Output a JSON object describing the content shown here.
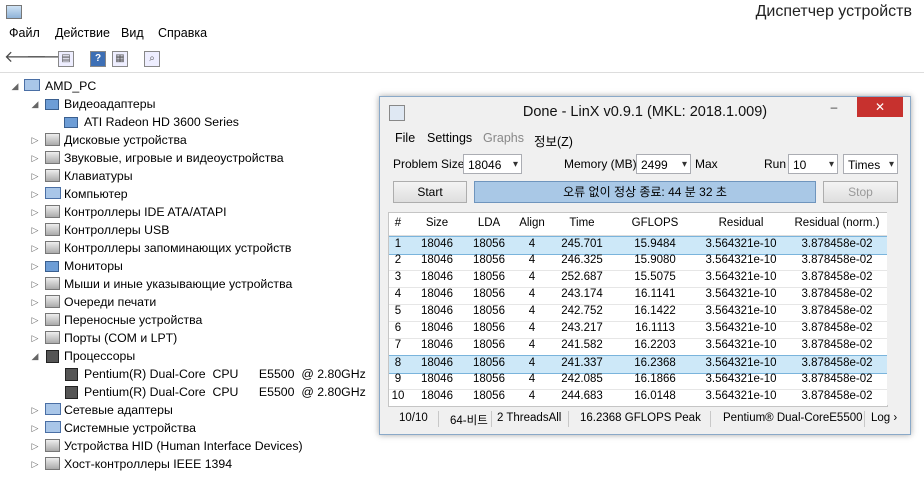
{
  "window": {
    "title": "Диспетчер устройств"
  },
  "menu": [
    "Файл",
    "Действие",
    "Вид",
    "Справка"
  ],
  "toolbar": {
    "back_icon": "back-arrow-icon",
    "forward_icon": "forward-arrow-icon",
    "help_label": "?"
  },
  "tree": {
    "root": "AMD_PC",
    "items": [
      {
        "label": "Видеоадаптеры",
        "expanded": true,
        "children": [
          "ATI Radeon HD 3600 Series"
        ]
      },
      {
        "label": "Дисковые устройства"
      },
      {
        "label": "Звуковые, игровые и видеоустройства"
      },
      {
        "label": "Клавиатуры"
      },
      {
        "label": "Компьютер"
      },
      {
        "label": "Контроллеры IDE ATA/ATAPI"
      },
      {
        "label": "Контроллеры USB"
      },
      {
        "label": "Контроллеры запоминающих устройств"
      },
      {
        "label": "Мониторы"
      },
      {
        "label": "Мыши и иные указывающие устройства"
      },
      {
        "label": "Очереди печати"
      },
      {
        "label": "Переносные устройства"
      },
      {
        "label": "Порты (COM и LPT)"
      },
      {
        "label": "Процессоры",
        "expanded": true,
        "children": [
          "Pentium(R) Dual-Core  CPU      E5500  @ 2.80GHz",
          "Pentium(R) Dual-Core  CPU      E5500  @ 2.80GHz"
        ]
      },
      {
        "label": "Сетевые адаптеры"
      },
      {
        "label": "Системные устройства"
      },
      {
        "label": "Устройства HID (Human Interface Devices)"
      },
      {
        "label": "Хост-контроллеры IEEE 1394"
      }
    ]
  },
  "linx": {
    "title": "Done - LinX v0.9.1 (MKL: 2018.1.009)",
    "minimize": "–",
    "close": "✕",
    "menu": [
      "File",
      "Settings",
      "Graphs",
      "정보(Z)"
    ],
    "problem_size_label": "Problem Size:",
    "problem_size": "18046",
    "memory_label": "Memory (MB):",
    "memory": "2499",
    "max_label": "Max",
    "run_label": "Run",
    "run": "10",
    "run_unit": "Times",
    "start": "Start",
    "status": "오류 없이 정상 종료: 44 분 32 초",
    "stop": "Stop",
    "columns": [
      "#",
      "Size",
      "LDA",
      "Align",
      "Time",
      "GFLOPS",
      "Residual",
      "Residual (norm.)"
    ],
    "rows": [
      [
        "1",
        "18046",
        "18056",
        "4",
        "245.701",
        "15.9484",
        "3.564321e-10",
        "3.878458e-02"
      ],
      [
        "2",
        "18046",
        "18056",
        "4",
        "246.325",
        "15.9080",
        "3.564321e-10",
        "3.878458e-02"
      ],
      [
        "3",
        "18046",
        "18056",
        "4",
        "252.687",
        "15.5075",
        "3.564321e-10",
        "3.878458e-02"
      ],
      [
        "4",
        "18046",
        "18056",
        "4",
        "243.174",
        "16.1141",
        "3.564321e-10",
        "3.878458e-02"
      ],
      [
        "5",
        "18046",
        "18056",
        "4",
        "242.752",
        "16.1422",
        "3.564321e-10",
        "3.878458e-02"
      ],
      [
        "6",
        "18046",
        "18056",
        "4",
        "243.217",
        "16.1113",
        "3.564321e-10",
        "3.878458e-02"
      ],
      [
        "7",
        "18046",
        "18056",
        "4",
        "241.582",
        "16.2203",
        "3.564321e-10",
        "3.878458e-02"
      ],
      [
        "8",
        "18046",
        "18056",
        "4",
        "241.337",
        "16.2368",
        "3.564321e-10",
        "3.878458e-02"
      ],
      [
        "9",
        "18046",
        "18056",
        "4",
        "242.085",
        "16.1866",
        "3.564321e-10",
        "3.878458e-02"
      ],
      [
        "10",
        "18046",
        "18056",
        "4",
        "244.683",
        "16.0148",
        "3.564321e-10",
        "3.878458e-02"
      ]
    ],
    "selected_rows": [
      "1",
      "8"
    ],
    "statusbar": [
      "10/10",
      "64-비트",
      "2 ThreadsAll",
      "16.2368 GFLOPS Peak",
      "Pentium® Dual-CoreE5500",
      "Log ›"
    ]
  }
}
